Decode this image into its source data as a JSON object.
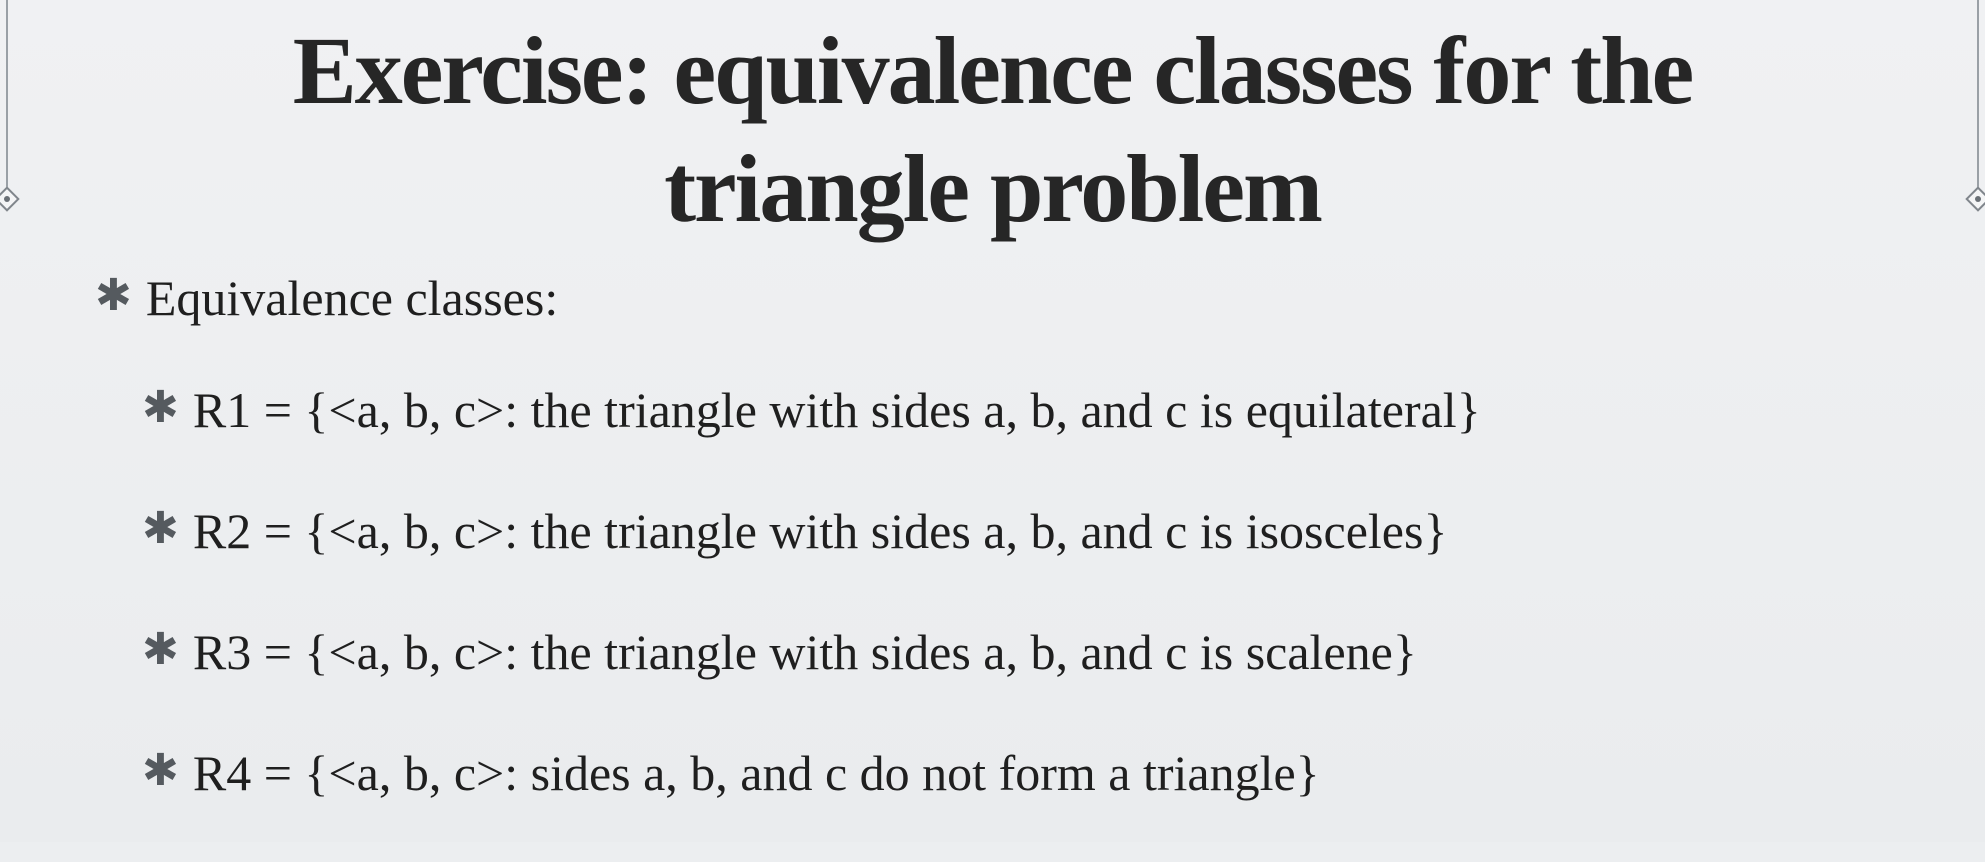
{
  "slide": {
    "title": "Exercise: equivalence classes for the triangle problem",
    "bullet_icon": "asterisk-icon",
    "items": [
      {
        "level": 1,
        "text": "Equivalence classes:"
      },
      {
        "level": 2,
        "text": "R1 = {<a, b, c>: the triangle with sides a, b, and c is equilateral}"
      },
      {
        "level": 2,
        "text": "R2 = {<a, b, c>: the triangle with sides a, b, and c is isosceles}"
      },
      {
        "level": 2,
        "text": "R3 = {<a, b, c>: the triangle with sides a, b, and c is scalene}"
      },
      {
        "level": 2,
        "text": "R4 = {<a, b, c>: sides a, b, and c do not form a triangle}"
      }
    ]
  },
  "colors": {
    "background": "#eceef0",
    "text": "#1f1f1f",
    "bullet": "#555a5f"
  }
}
